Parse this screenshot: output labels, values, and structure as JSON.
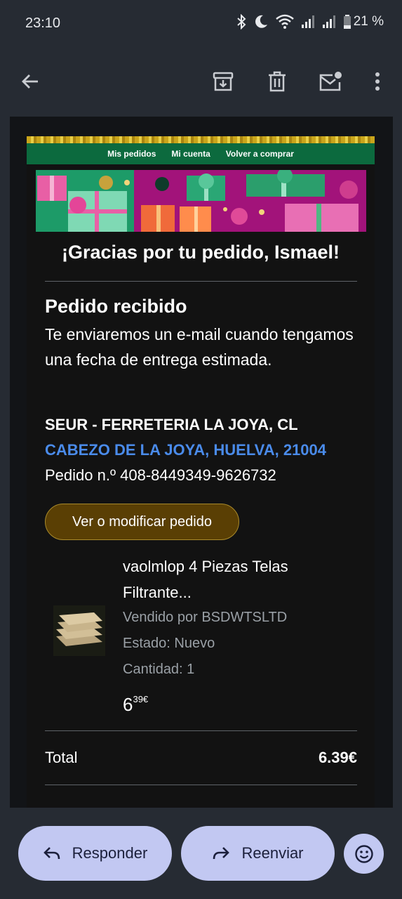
{
  "status_bar": {
    "time": "23:10",
    "battery": "21 %",
    "icons": [
      "bluetooth-icon",
      "dnd-moon-icon",
      "wifi-icon",
      "signal-icon",
      "signal-icon",
      "battery-icon"
    ]
  },
  "toolbar": {
    "icons": [
      "back-arrow-icon",
      "archive-icon",
      "delete-icon",
      "mark-unread-icon",
      "more-vert-icon"
    ]
  },
  "email": {
    "nav": [
      "Mis pedidos",
      "Mi cuenta",
      "Volver a comprar"
    ],
    "thanks": "¡Gracias por tu pedido, Ismael!",
    "received_title": "Pedido recibido",
    "received_text": "Te enviaremos un e-mail cuando tengamos una fecha de entrega estimada.",
    "address_line1": "SEUR - FERRETERIA LA JOYA, CL",
    "address_line2": "CABEZO DE LA JOYA, HUELVA, 21004",
    "order_number": "Pedido n.º 408-8449349-9626732",
    "view_button": "Ver o modificar pedido",
    "product": {
      "title": "vaolmlop 4 Piezas Telas Filtrante...",
      "seller": "Vendido por BSDWTSLTD",
      "condition": "Estado: Nuevo",
      "quantity": "Cantidad: 1",
      "price_int": "6",
      "price_dec": "39€"
    },
    "total_label": "Total",
    "total_value": "6.39€",
    "colors": {
      "nav_green": "#0c6a3e",
      "link_blue": "#4a8bea",
      "button_brown": "#5a3f04"
    }
  },
  "bottom_bar": {
    "reply": "Responder",
    "forward": "Reenviar",
    "emoji_icon": "smiley-icon"
  }
}
